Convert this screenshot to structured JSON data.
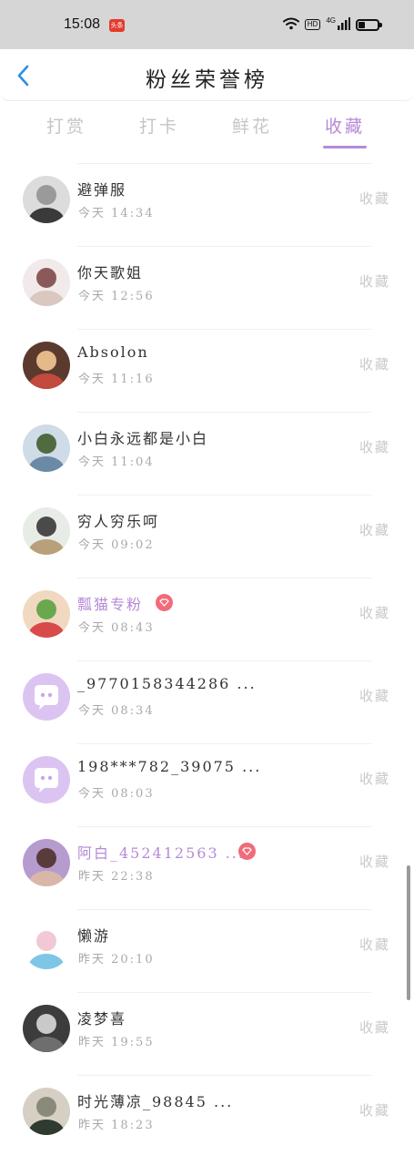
{
  "status_bar": {
    "time": "15:08",
    "app_badge": "头条",
    "hd": "HD",
    "network": "4G",
    "battery_level": 0.3
  },
  "header": {
    "title": "粉丝荣誉榜"
  },
  "tabs": [
    {
      "label": "打赏",
      "active": false
    },
    {
      "label": "打卡",
      "active": false
    },
    {
      "label": "鲜花",
      "active": false
    },
    {
      "label": "收藏",
      "active": true
    }
  ],
  "list": [
    {
      "name": "避弹服",
      "time": "今天 14:34",
      "tag": "收藏",
      "highlight": false,
      "vip": false,
      "avatar_icon": "user-photo-icon"
    },
    {
      "name": "你天歌姐",
      "time": "今天 12:56",
      "tag": "收藏",
      "highlight": false,
      "vip": false,
      "avatar_icon": "user-photo-icon"
    },
    {
      "name": "Absolon",
      "time": "今天 11:16",
      "tag": "收藏",
      "highlight": false,
      "vip": false,
      "avatar_icon": "user-photo-icon"
    },
    {
      "name": "小白永远都是小白",
      "time": "今天 11:04",
      "tag": "收藏",
      "highlight": false,
      "vip": false,
      "avatar_icon": "user-photo-icon"
    },
    {
      "name": "穷人穷乐呵",
      "time": "今天 09:02",
      "tag": "收藏",
      "highlight": false,
      "vip": false,
      "avatar_icon": "user-photo-icon"
    },
    {
      "name": "瓢猫专粉",
      "time": "今天 08:43",
      "tag": "收藏",
      "highlight": true,
      "vip": true,
      "avatar_icon": "user-photo-icon"
    },
    {
      "name": "_9770158344286 ...",
      "time": "今天 08:34",
      "tag": "收藏",
      "highlight": false,
      "vip": false,
      "avatar_icon": "default-chat-avatar-icon"
    },
    {
      "name": "198***782_39075 ...",
      "time": "今天 08:03",
      "tag": "收藏",
      "highlight": false,
      "vip": false,
      "avatar_icon": "default-chat-avatar-icon"
    },
    {
      "name": "阿白_452412563 ...",
      "time": "昨天 22:38",
      "tag": "收藏",
      "highlight": true,
      "vip": true,
      "avatar_icon": "user-photo-icon"
    },
    {
      "name": "懒游",
      "time": "昨天 20:10",
      "tag": "收藏",
      "highlight": false,
      "vip": false,
      "avatar_icon": "user-photo-icon"
    },
    {
      "name": "凌梦喜",
      "time": "昨天 19:55",
      "tag": "收藏",
      "highlight": false,
      "vip": false,
      "avatar_icon": "user-photo-icon"
    },
    {
      "name": "时光薄凉_98845 ...",
      "time": "昨天 18:23",
      "tag": "收藏",
      "highlight": false,
      "vip": false,
      "avatar_icon": "user-photo-icon"
    }
  ],
  "colors": {
    "accent": "#b58ad6",
    "vip_badge": "#f26b7a",
    "tab_inactive": "#c5c5c5"
  }
}
